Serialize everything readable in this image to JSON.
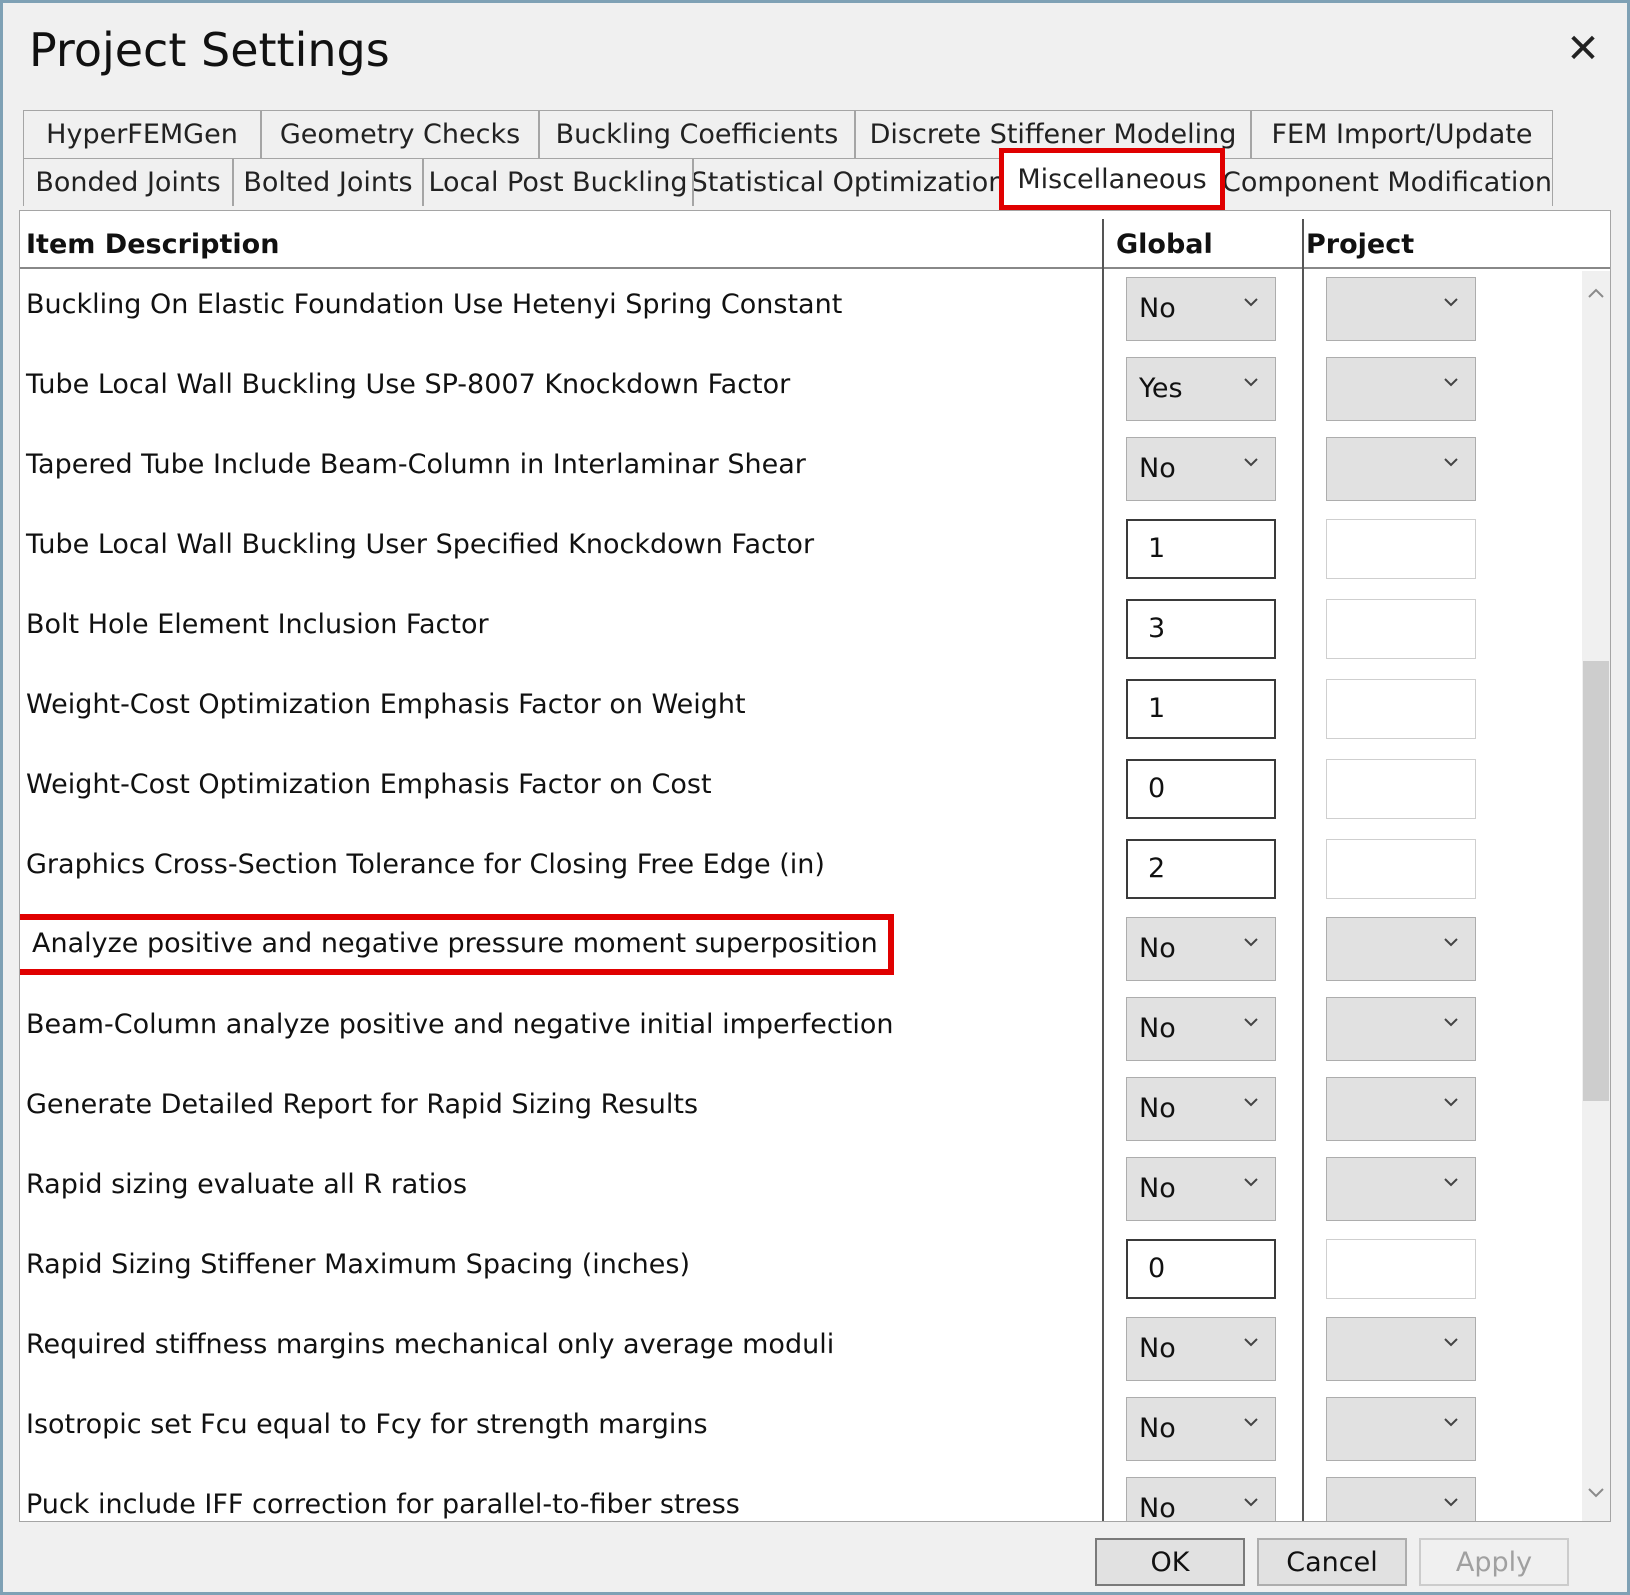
{
  "window": {
    "title": "Project Settings",
    "close_label": "✕"
  },
  "tabs_row1": [
    {
      "label": "HyperFEMGen"
    },
    {
      "label": "Geometry Checks"
    },
    {
      "label": "Buckling Coefficients"
    },
    {
      "label": "Discrete Stiffener Modeling"
    },
    {
      "label": "FEM Import/Update"
    }
  ],
  "tabs_row2": [
    {
      "label": "Bonded Joints"
    },
    {
      "label": "Bolted Joints"
    },
    {
      "label": "Local Post Buckling"
    },
    {
      "label": "Statistical Optimization"
    },
    {
      "label": "Miscellaneous",
      "active": true
    },
    {
      "label": "Component Modification"
    }
  ],
  "table": {
    "headers": {
      "description": "Item Description",
      "global": "Global",
      "project": "Project"
    },
    "rows": [
      {
        "description": "Buckling On Elastic Foundation Use Hetenyi Spring Constant",
        "kind": "combo",
        "global": "No",
        "project": ""
      },
      {
        "description": "Tube Local Wall Buckling Use SP-8007 Knockdown Factor",
        "kind": "combo",
        "global": "Yes",
        "project": ""
      },
      {
        "description": "Tapered Tube Include Beam-Column in Interlaminar Shear",
        "kind": "combo",
        "global": "No",
        "project": ""
      },
      {
        "description": "Tube Local Wall Buckling User Specified Knockdown Factor",
        "kind": "text",
        "global": "1",
        "project": ""
      },
      {
        "description": "Bolt Hole Element Inclusion Factor",
        "kind": "text",
        "global": "3",
        "project": ""
      },
      {
        "description": "Weight-Cost Optimization Emphasis Factor on Weight",
        "kind": "text",
        "global": "1",
        "project": ""
      },
      {
        "description": "Weight-Cost Optimization Emphasis Factor on Cost",
        "kind": "text",
        "global": "0",
        "project": ""
      },
      {
        "description": "Graphics Cross-Section Tolerance for Closing Free Edge (in)",
        "kind": "text",
        "global": "2",
        "project": ""
      },
      {
        "description": "Analyze positive and negative pressure moment superposition",
        "kind": "combo",
        "global": "No",
        "project": "",
        "highlight": true
      },
      {
        "description": "Beam-Column analyze positive and negative initial imperfection",
        "kind": "combo",
        "global": "No",
        "project": ""
      },
      {
        "description": "Generate Detailed Report for Rapid Sizing Results",
        "kind": "combo",
        "global": "No",
        "project": ""
      },
      {
        "description": "Rapid sizing evaluate all R ratios",
        "kind": "combo",
        "global": "No",
        "project": ""
      },
      {
        "description": "Rapid Sizing Stiffener Maximum Spacing (inches)",
        "kind": "text",
        "global": "0",
        "project": ""
      },
      {
        "description": "Required stiffness margins mechanical only average moduli",
        "kind": "combo",
        "global": "No",
        "project": ""
      },
      {
        "description": "Isotropic set Fcu equal to Fcy for strength margins",
        "kind": "combo",
        "global": "No",
        "project": ""
      },
      {
        "description": "Puck include IFF correction for parallel-to-fiber stress",
        "kind": "combo",
        "global": "No",
        "project": ""
      }
    ]
  },
  "footer": {
    "ok": "OK",
    "cancel": "Cancel",
    "apply": "Apply"
  },
  "colors": {
    "highlight": "#e00000",
    "window_border": "#7fa1b5"
  }
}
